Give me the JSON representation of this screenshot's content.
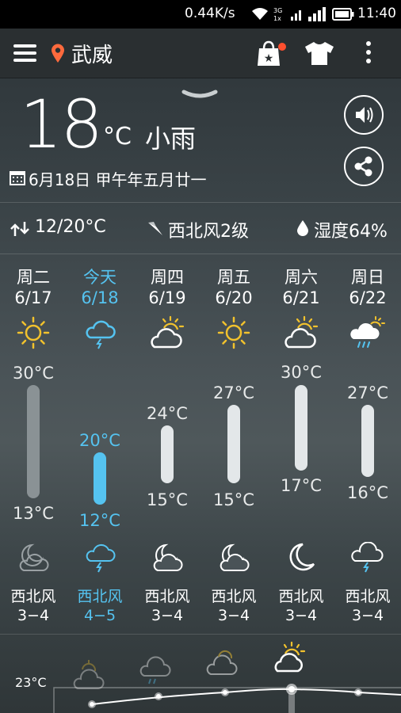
{
  "status_bar": {
    "speed": "0.44K/s",
    "time": "11:40"
  },
  "header": {
    "city": "武威"
  },
  "current": {
    "temp": "18",
    "unit": "°C",
    "condition": "小雨",
    "date": "6月18日 甲午年五月廿一"
  },
  "summary": {
    "temp_range": "12/20°C",
    "wind": "西北风2级",
    "humidity": "湿度64%"
  },
  "forecast": [
    {
      "day": "周二",
      "date": "6/17",
      "high": "30°C",
      "low": "13°C",
      "wind_dir": "西北风",
      "wind_level": "3−4"
    },
    {
      "day": "今天",
      "date": "6/18",
      "high": "20°C",
      "low": "12°C",
      "wind_dir": "西北风",
      "wind_level": "4−5"
    },
    {
      "day": "周四",
      "date": "6/19",
      "high": "24°C",
      "low": "15°C",
      "wind_dir": "西北风",
      "wind_level": "3−4"
    },
    {
      "day": "周五",
      "date": "6/20",
      "high": "27°C",
      "low": "15°C",
      "wind_dir": "西北风",
      "wind_level": "3−4"
    },
    {
      "day": "周六",
      "date": "6/21",
      "high": "30°C",
      "low": "17°C",
      "wind_dir": "西北风",
      "wind_level": "3−4"
    },
    {
      "day": "周日",
      "date": "6/22",
      "high": "27°C",
      "low": "16°C",
      "wind_dir": "西北风",
      "wind_level": "3−4"
    }
  ],
  "hourly_graph": {
    "label": "23°C"
  },
  "colors": {
    "accent": "#55c3f0",
    "location": "#ff6a3d",
    "sun": "#f2c22d"
  }
}
